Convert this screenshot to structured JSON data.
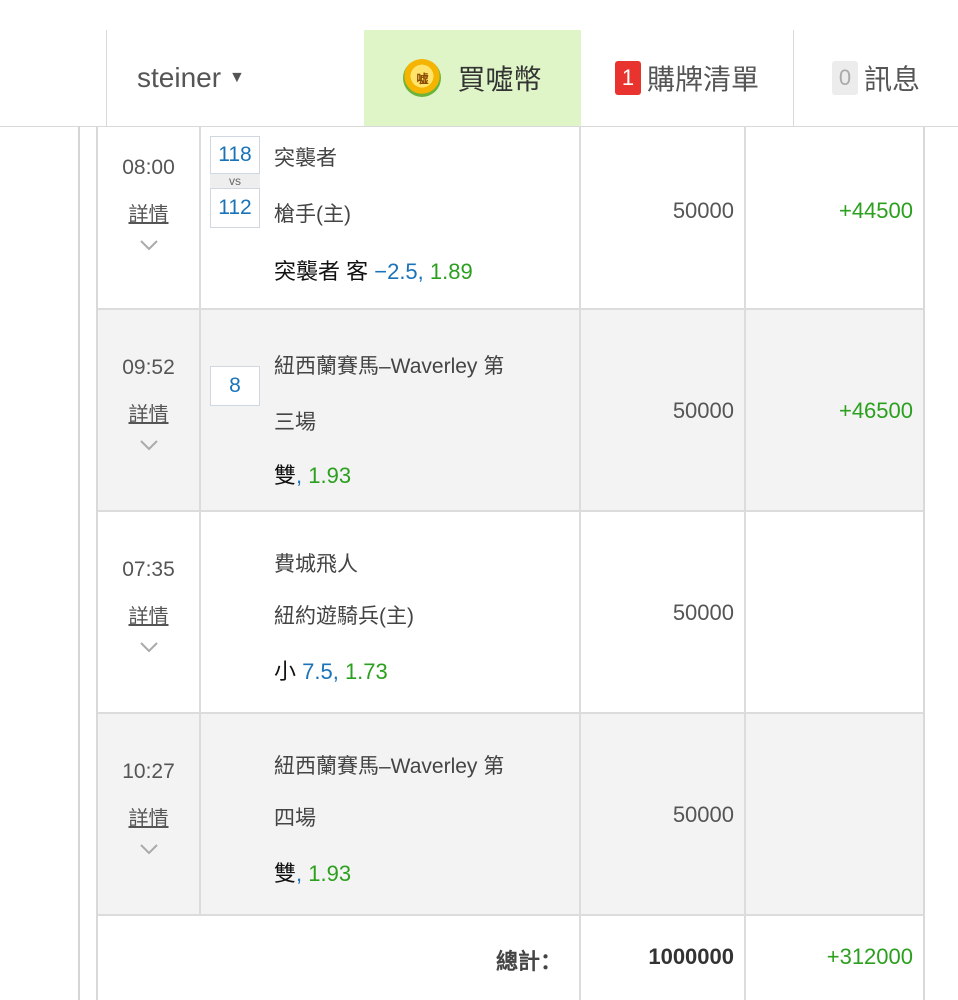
{
  "nav": {
    "username": "steiner",
    "coin_icon_text": "嘘",
    "coin_label": "買噓幣",
    "cart_count": "1",
    "cart_label": "購牌清單",
    "msg_count": "0",
    "msg_label": "訊息"
  },
  "bets": [
    {
      "time": "08:00",
      "detail": "詳情",
      "num1": "118",
      "vs": "vs",
      "num2": "112",
      "line1": "突襲者",
      "line2": "槍手(主)",
      "pick_label": "突襲者 客 ",
      "pick_handicap": "−2.5,",
      "pick_odds": " 1.89",
      "stake": "50000",
      "win": "+44500"
    },
    {
      "time": "09:52",
      "detail": "詳情",
      "num": "8",
      "line1": "紐西蘭賽馬–Waverley 第",
      "line2": "三場",
      "pick_label": "雙",
      "pick_handicap": ",",
      "pick_odds": " 1.93",
      "stake": "50000",
      "win": "+46500"
    },
    {
      "time": "07:35",
      "detail": "詳情",
      "line1": "費城飛人",
      "line2": "紐約遊騎兵(主)",
      "pick_label": "小 ",
      "pick_handicap": "7.5,",
      "pick_odds": " 1.73",
      "stake": "50000",
      "win": ""
    },
    {
      "time": "10:27",
      "detail": "詳情",
      "line1": "紐西蘭賽馬–Waverley 第",
      "line2": "四場",
      "pick_label": "雙",
      "pick_handicap": ",",
      "pick_odds": " 1.93",
      "stake": "50000",
      "win": ""
    }
  ],
  "total": {
    "label": "總計：",
    "stake": "1000000",
    "win": "+312000"
  }
}
